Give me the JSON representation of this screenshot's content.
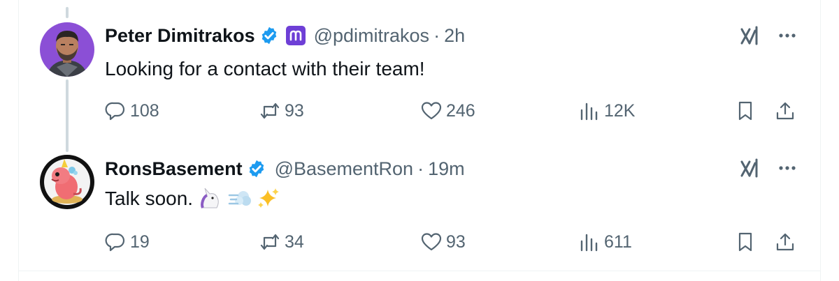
{
  "thread": {
    "tweets": [
      {
        "name": "Peter Dimitrakos",
        "handle": "@pdimitrakos",
        "separator": "·",
        "time": "2h",
        "text": "Looking for a contact with their team!",
        "verified": true,
        "affiliation_badge": true,
        "avatar": "person-avatar",
        "replies": "108",
        "reposts": "93",
        "likes": "246",
        "views": "12K"
      },
      {
        "name": "RonsBasement",
        "handle": "@BasementRon",
        "separator": "·",
        "time": "19m",
        "text": "Talk soon. ",
        "emojis": [
          "unicorn-emoji",
          "dash-emoji",
          "sparkles-emoji"
        ],
        "verified": true,
        "avatar": "cartoon-avatar",
        "replies": "19",
        "reposts": "34",
        "likes": "93",
        "views": "611"
      }
    ]
  },
  "colors": {
    "text": "#0f1419",
    "secondary": "#536471",
    "verified_blue": "#1d9bf0",
    "affiliation_purple": "#6e3fd6",
    "thread_line": "#cfd9de",
    "divider": "#eff3f4"
  },
  "icons": [
    "reply-icon",
    "repost-icon",
    "like-icon",
    "views-icon",
    "bookmark-icon",
    "share-icon",
    "grok-icon",
    "more-icon",
    "verified-icon"
  ]
}
